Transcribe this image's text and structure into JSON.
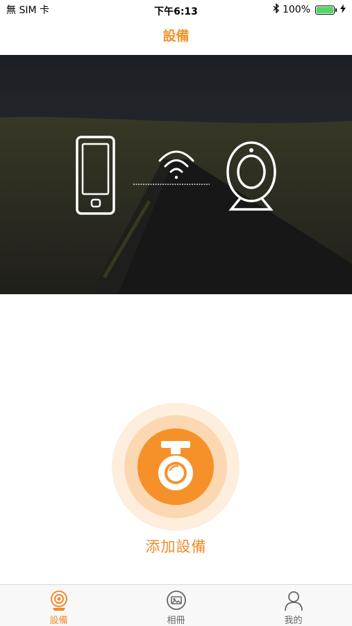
{
  "status_bar": {
    "carrier": "無 SIM 卡",
    "time": "下午6:13",
    "battery_percent": "100%",
    "battery_level": 1.0,
    "bluetooth_icon": "bluetooth-icon",
    "charging_icon": "charging-bolt-icon"
  },
  "nav": {
    "title": "設備"
  },
  "hero": {
    "icons": [
      "phone-icon",
      "wifi-icon",
      "camera-icon"
    ]
  },
  "main": {
    "add_device_label": "添加設備",
    "add_device_icon": "dashcam-icon"
  },
  "tabbar": {
    "tabs": [
      {
        "label": "設備",
        "icon": "device-camera-icon",
        "active": true
      },
      {
        "label": "相冊",
        "icon": "album-icon",
        "active": false
      },
      {
        "label": "我的",
        "icon": "profile-icon",
        "active": false
      }
    ]
  },
  "colors": {
    "accent": "#f4922a",
    "accent_light": "#fdeedd",
    "accent_mid": "#fcd8b2",
    "battery_green": "#4cd964"
  }
}
